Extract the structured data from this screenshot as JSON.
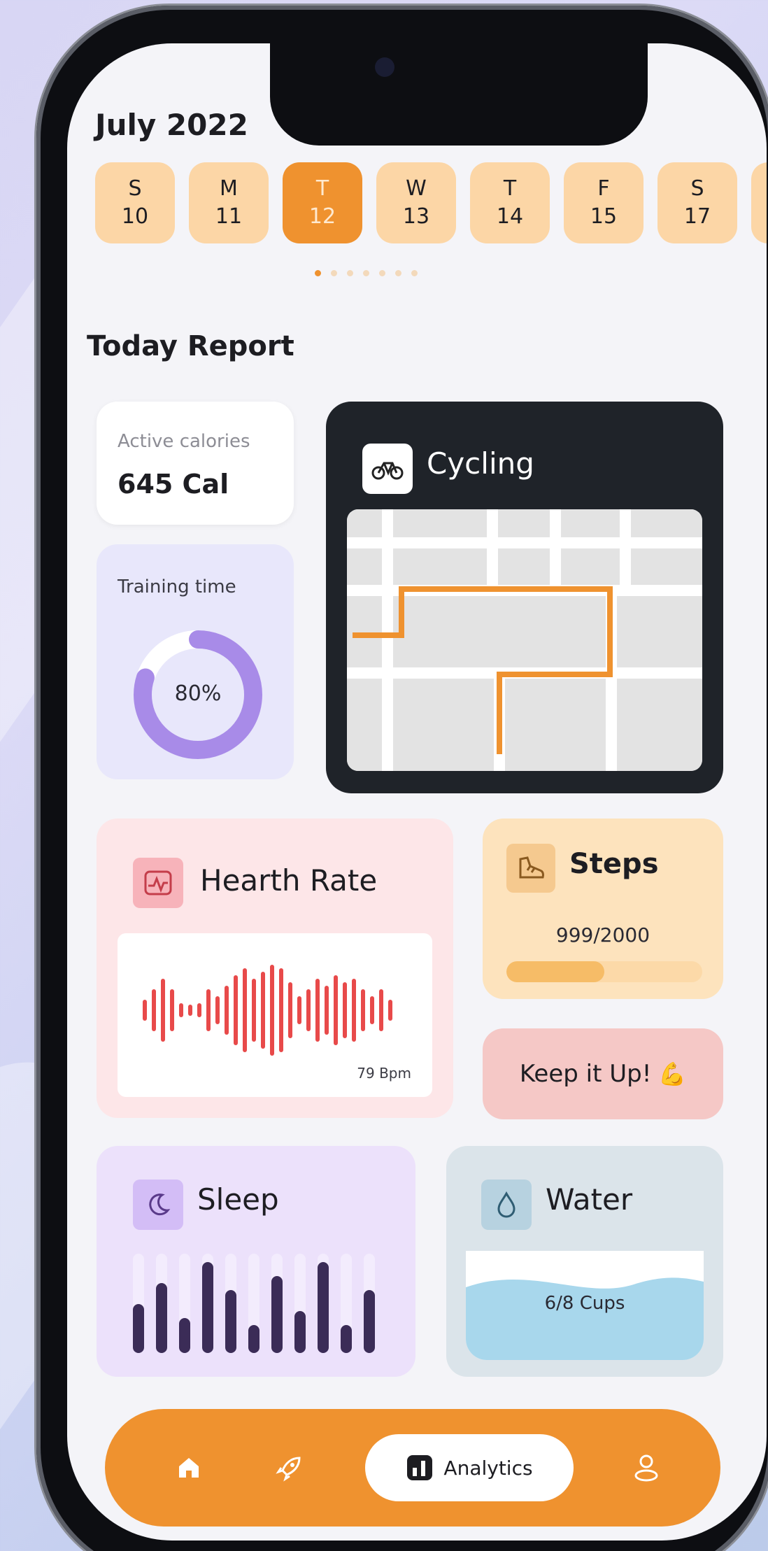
{
  "calendar": {
    "month": "July 2022",
    "days": [
      {
        "weekday": "S",
        "date": "10"
      },
      {
        "weekday": "M",
        "date": "11"
      },
      {
        "weekday": "T",
        "date": "12"
      },
      {
        "weekday": "W",
        "date": "13"
      },
      {
        "weekday": "T",
        "date": "14"
      },
      {
        "weekday": "F",
        "date": "15"
      },
      {
        "weekday": "S",
        "date": "17"
      }
    ],
    "selected_index": 2,
    "page_count": 7,
    "current_page": 0
  },
  "report": {
    "title": "Today Report",
    "active_calories": {
      "label": "Active calories",
      "value": "645 Cal"
    },
    "training_time": {
      "label": "Training time",
      "value": "80%",
      "fraction": 0.8
    },
    "cycling": {
      "title": "Cycling",
      "icon": "bicycle-icon"
    },
    "heart_rate": {
      "title": "Hearth Rate",
      "value": "79 Bpm",
      "icon": "heart-monitor-icon"
    },
    "steps": {
      "title": "Steps",
      "value": "999/2000",
      "progress": 0.4995,
      "icon": "shoe-icon"
    },
    "motivation": {
      "text": "Keep it Up!",
      "emoji": "💪"
    },
    "sleep": {
      "title": "Sleep",
      "icon": "moon-icon"
    },
    "water": {
      "title": "Water",
      "value": "6/8 Cups",
      "icon": "water-drop-icon"
    }
  },
  "nav": {
    "items": [
      "home-icon",
      "rocket-icon",
      "analytics-icon",
      "profile-icon"
    ],
    "active_label": "Analytics"
  },
  "colors": {
    "accent": "#ef922f",
    "day_chip": "#fcd6a6",
    "heart_wave": "#e84a4a",
    "sleep_bar": "#3b2c57",
    "water": "#a8d7ec",
    "training_ring": "#a88be8"
  }
}
